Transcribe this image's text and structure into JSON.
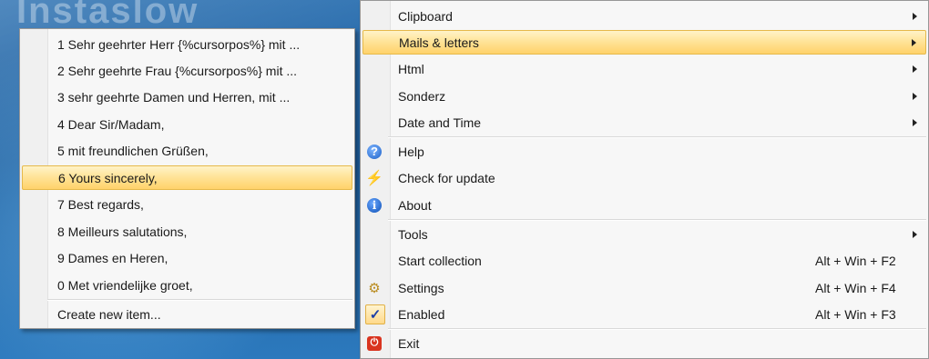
{
  "desktop": {
    "background_text": "Instaslow"
  },
  "submenu": {
    "items": [
      {
        "label": "1 Sehr geehrter Herr {%cursorpos%}  mit ..."
      },
      {
        "label": "2 Sehr geehrte Frau {%cursorpos%}  mit ..."
      },
      {
        "label": "3 sehr geehrte Damen und Herren,   mit ..."
      },
      {
        "label": "4 Dear Sir/Madam,"
      },
      {
        "label": "5 mit freundlichen Grüßen,"
      },
      {
        "label": "6 Yours sincerely,"
      },
      {
        "label": "7 Best regards,"
      },
      {
        "label": "8 Meilleurs salutations,"
      },
      {
        "label": "9 Dames en Heren,"
      },
      {
        "label": "0 Met vriendelijke groet,"
      }
    ],
    "create_label": "Create new item...",
    "highlighted_index": 5
  },
  "mainmenu": {
    "clipboard": "Clipboard",
    "mails": "Mails & letters",
    "html": "Html",
    "sonderz": "Sonderz",
    "datetime": "Date and Time",
    "help": "Help",
    "check_update": "Check for update",
    "about": "About",
    "tools": "Tools",
    "start_collection": "Start collection",
    "start_collection_shortcut": "Alt + Win + F2",
    "settings": "Settings",
    "settings_shortcut": "Alt + Win + F4",
    "enabled": "Enabled",
    "enabled_shortcut": "Alt + Win + F3",
    "exit": "Exit"
  },
  "colors": {
    "highlight": "#ffd26a",
    "desktop": "#1f5f9e"
  }
}
